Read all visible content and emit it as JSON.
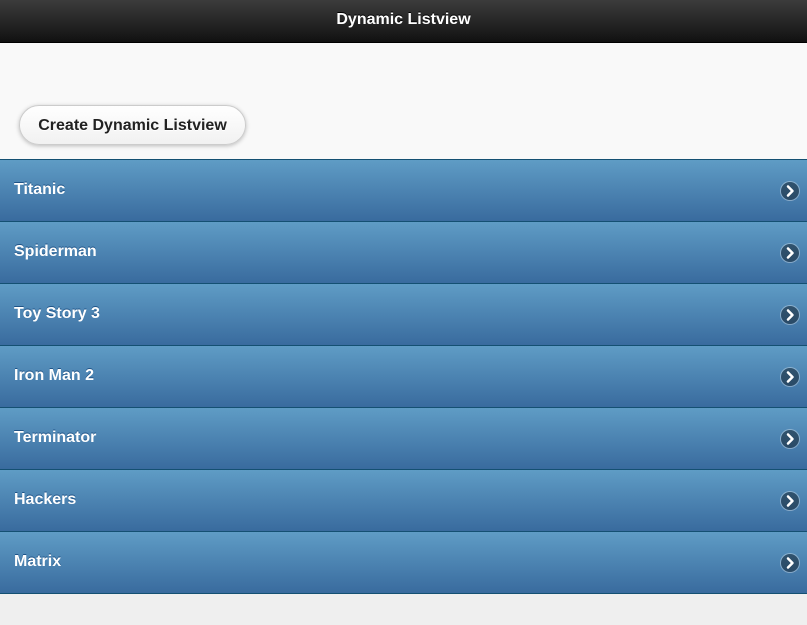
{
  "header": {
    "title": "Dynamic Listview"
  },
  "toolbar": {
    "create_label": "Create Dynamic Listview"
  },
  "list": {
    "items": [
      {
        "label": "Titanic"
      },
      {
        "label": "Spiderman"
      },
      {
        "label": "Toy Story 3"
      },
      {
        "label": "Iron Man 2"
      },
      {
        "label": "Terminator"
      },
      {
        "label": "Hackers"
      },
      {
        "label": "Matrix"
      }
    ]
  },
  "icons": {
    "list_item_icon": "chevron-right-icon"
  },
  "colors": {
    "header_bg": "#1b1b1b",
    "list_bg_top": "#5f9cc5",
    "list_bg_bottom": "#396b9e",
    "page_bg": "#f9f9f9"
  }
}
